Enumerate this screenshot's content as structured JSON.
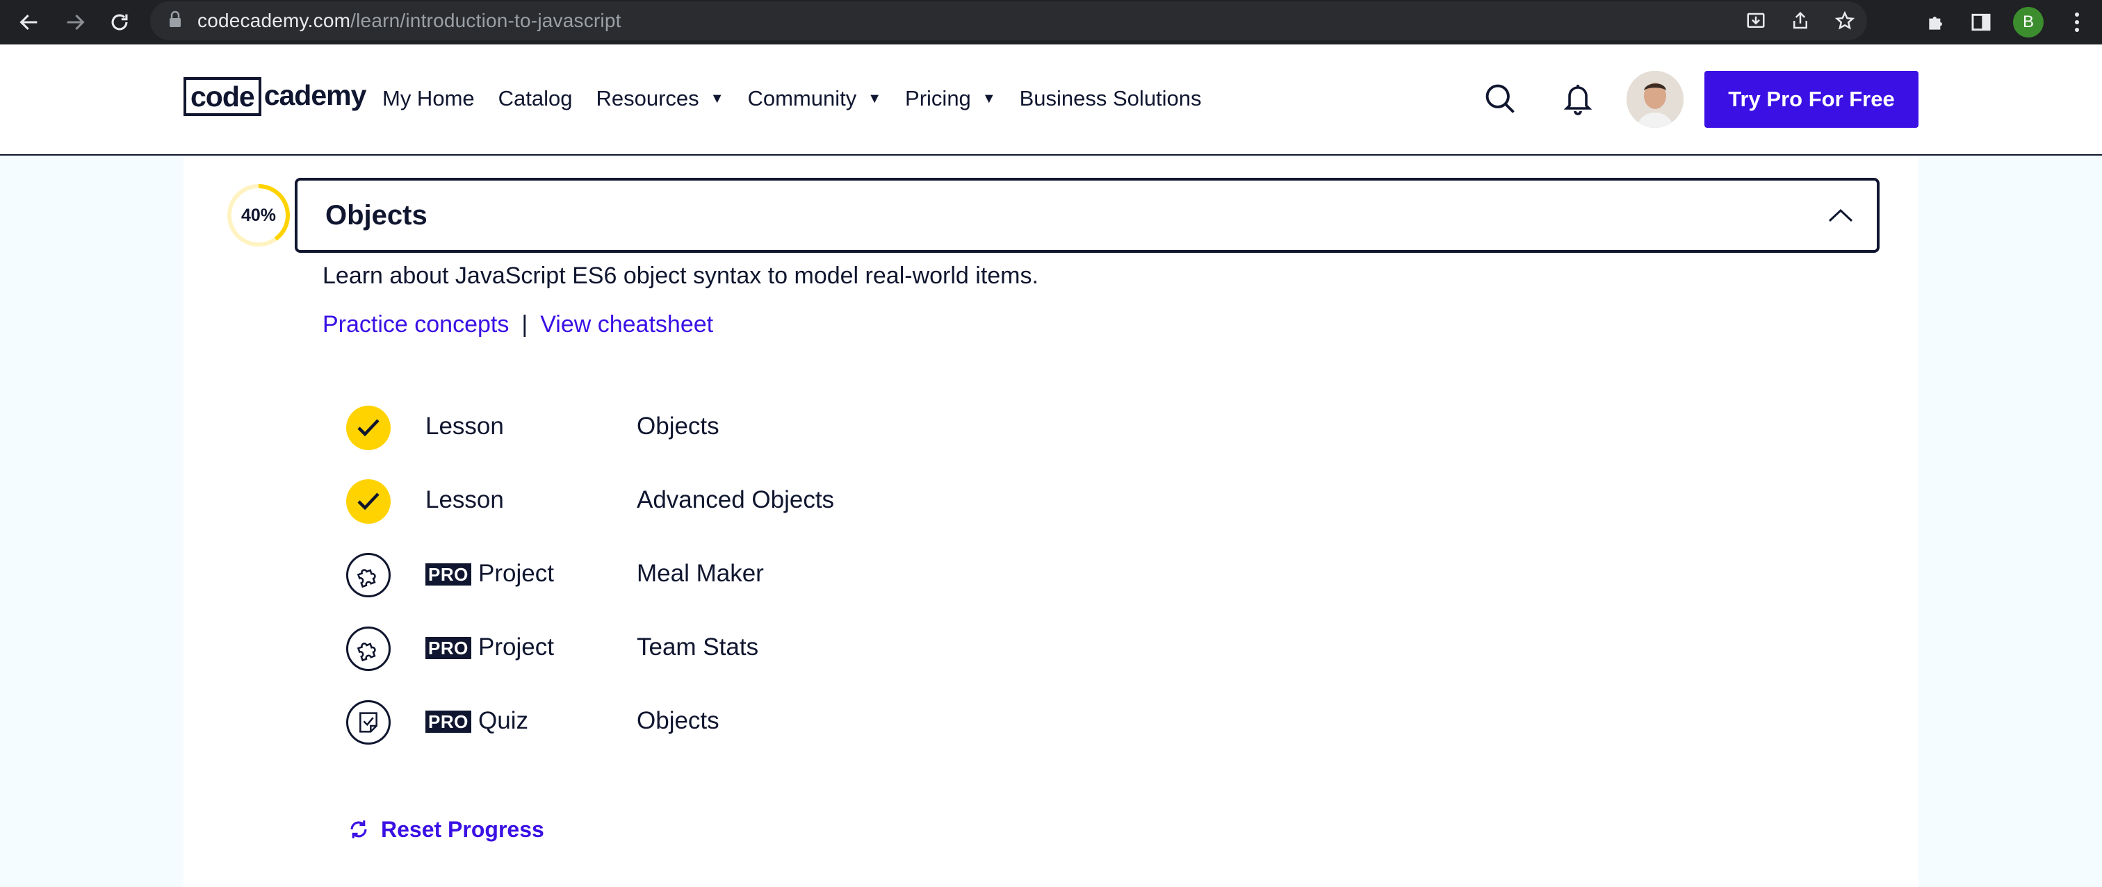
{
  "browser": {
    "url_domain": "codecademy.com",
    "url_path": "/learn/introduction-to-javascript",
    "profile_initial": "B",
    "profile_color": "#3c8d2e"
  },
  "header": {
    "logo_left": "code",
    "logo_right": "cademy",
    "nav": [
      {
        "label": "My Home",
        "dropdown": false
      },
      {
        "label": "Catalog",
        "dropdown": false
      },
      {
        "label": "Resources",
        "dropdown": true
      },
      {
        "label": "Community",
        "dropdown": true
      },
      {
        "label": "Pricing",
        "dropdown": true
      },
      {
        "label": "Business Solutions",
        "dropdown": false
      }
    ],
    "caret": "▼",
    "cta_label": "Try Pro For Free",
    "cta_color": "#3a10e5"
  },
  "module": {
    "progress_label": "40%",
    "progress_fraction": 0.4,
    "title": "Objects",
    "description": "Learn about JavaScript ES6 object syntax to model real-world items.",
    "practice_link": "Practice concepts",
    "separator": "|",
    "cheatsheet_link": "View cheatsheet",
    "items": [
      {
        "status": "complete",
        "icon": "check-icon",
        "pro": false,
        "kind": "Lesson",
        "name": "Objects"
      },
      {
        "status": "complete",
        "icon": "check-icon",
        "pro": false,
        "kind": "Lesson",
        "name": "Advanced Objects"
      },
      {
        "status": "incomplete",
        "icon": "puzzle-icon",
        "pro": true,
        "kind": "Project",
        "name": "Meal Maker"
      },
      {
        "status": "incomplete",
        "icon": "puzzle-icon",
        "pro": true,
        "kind": "Project",
        "name": "Team Stats"
      },
      {
        "status": "incomplete",
        "icon": "quiz-icon",
        "pro": true,
        "kind": "Quiz",
        "name": "Objects"
      }
    ],
    "pro_badge": "PRO",
    "reset_label": "Reset Progress"
  },
  "colors": {
    "accent": "#3a10e5",
    "complete": "#ffd300",
    "navy": "#10162f"
  }
}
